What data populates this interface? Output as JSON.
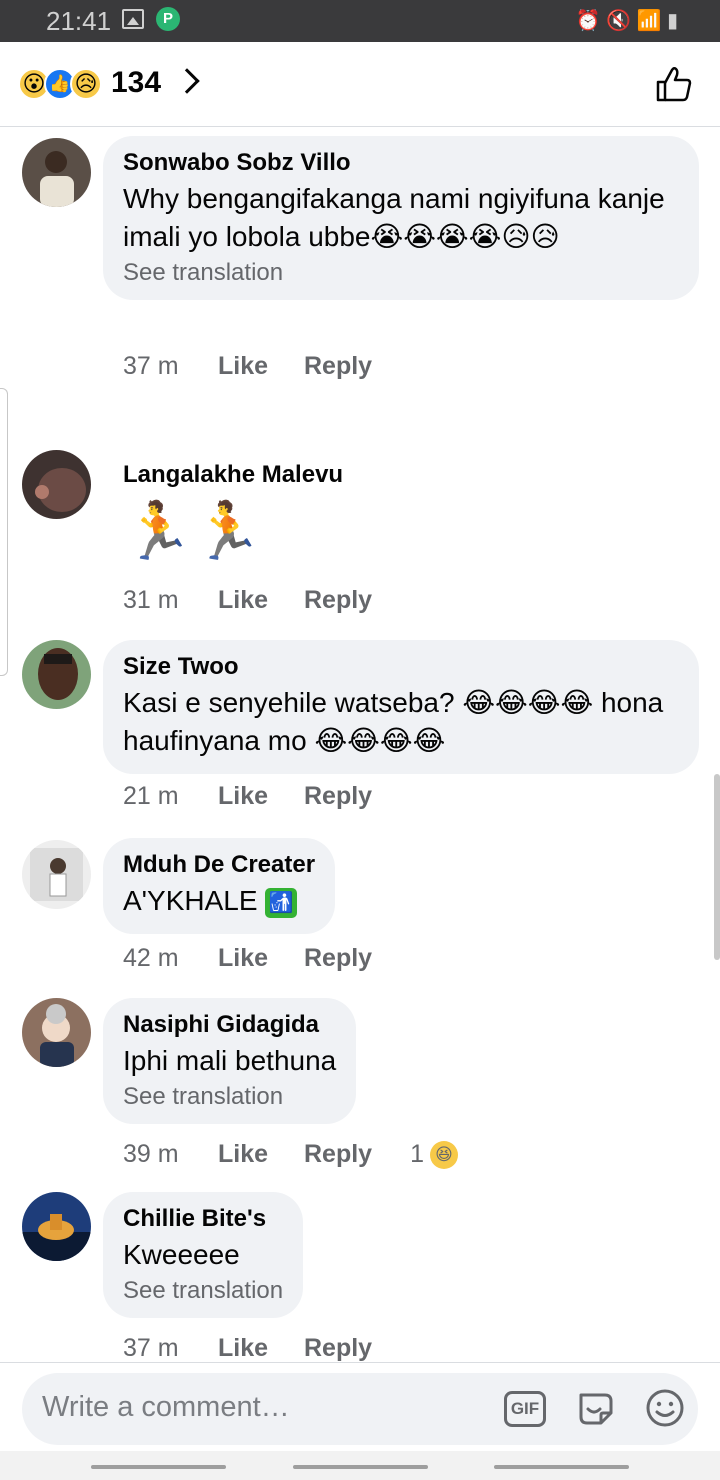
{
  "status_bar": {
    "time": "21:41",
    "right_icons": [
      "alarm-icon",
      "mute-icon",
      "wifi-icon",
      "signal-icon",
      "battery-icon"
    ],
    "right_glyphs": "⏰ 🔇 📶 ▮"
  },
  "header": {
    "reactions": [
      "wow",
      "like",
      "sad"
    ],
    "reaction_glyphs": [
      "😮",
      "👍",
      "😥"
    ],
    "count": "134"
  },
  "comments": [
    {
      "name": "Sonwabo Sobz Villo",
      "text": "Why bengangifakanga nami ngiyifuna kanje imali yo lobola ubbe😭😭😭😭😥😥",
      "translation": "See translation",
      "time": "37 m",
      "like": "Like",
      "reply": "Reply"
    },
    {
      "name": "Langalakhe Malevu",
      "text": "🏃🏃",
      "time": "31 m",
      "like": "Like",
      "reply": "Reply"
    },
    {
      "name": "Size Twoo",
      "text": "Kasi e senyehile watseba? 😂😂😂😂 hona haufinyana mo 😂😂😂😂",
      "time": "21 m",
      "like": "Like",
      "reply": "Reply"
    },
    {
      "name": "Mduh De Creater",
      "text": "A'YKHALE",
      "trailing_glyph": "🚮",
      "time": "42 m",
      "like": "Like",
      "reply": "Reply"
    },
    {
      "name": "Nasiphi Gidagida",
      "text": "Iphi mali bethuna",
      "translation": "See translation",
      "time": "39 m",
      "like": "Like",
      "reply": "Reply",
      "reaction_count": "1",
      "reaction_glyph": "😆"
    },
    {
      "name": "Chillie Bite's",
      "text": "Kweeeee",
      "translation": "See translation",
      "time": "37 m",
      "like": "Like",
      "reply": "Reply"
    }
  ],
  "composer": {
    "placeholder": "Write a comment…",
    "gif_label": "GIF"
  },
  "colors": {
    "bubble": "#f0f2f5",
    "secondary_text": "#65676b",
    "like_blue": "#1877f2"
  }
}
